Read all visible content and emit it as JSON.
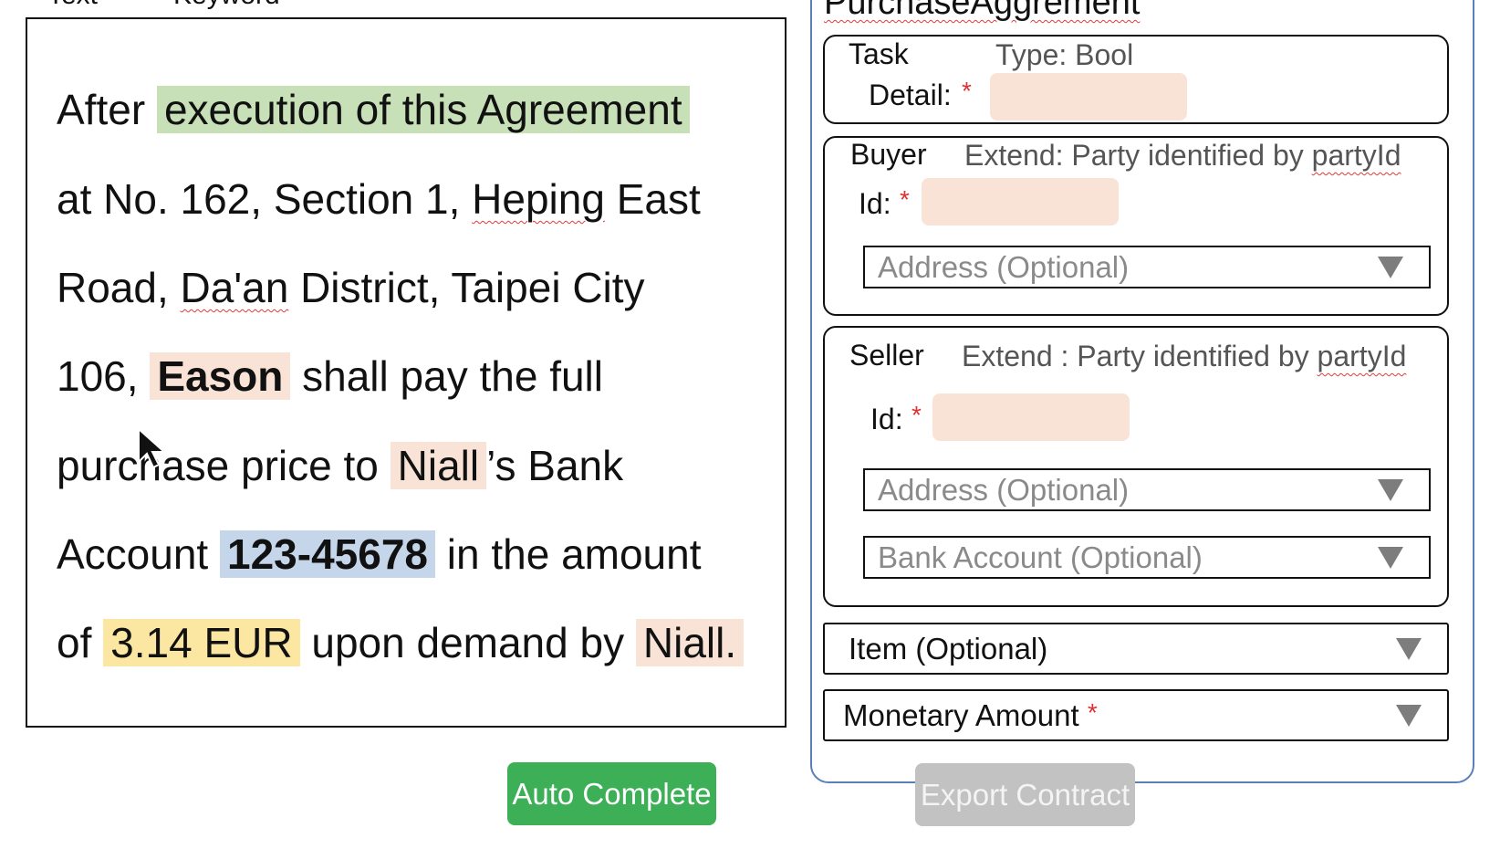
{
  "top_labels": {
    "text": "Text",
    "keyword": "Keyword"
  },
  "form": {
    "title": "PurchaseAggrement",
    "task": {
      "label_1": "Task",
      "label_2": "Detail:",
      "type": "Type: Bool",
      "required": "*"
    },
    "buyer": {
      "label": "Buyer",
      "extend_prefix": "Extend: Party identified by ",
      "extend_word": "partyId",
      "id_label": "Id:",
      "required": "*",
      "address_placeholder": "Address (Optional)"
    },
    "seller": {
      "label": "Seller",
      "extend_prefix": "Extend : Party identified by ",
      "extend_word": "partyId",
      "id_label": "Id:",
      "required": "*",
      "address_placeholder": "Address (Optional)",
      "bank_placeholder": "Bank Account (Optional)"
    },
    "item": {
      "label": "Item (Optional)"
    },
    "monetary": {
      "label": "Monetary Amount",
      "required": "*"
    }
  },
  "contract_text": {
    "l1_a": "After ",
    "l1_hl": "execution of this Agreement",
    "l2_a": "at No. 162, Section 1, ",
    "l2_sq": "Heping",
    "l2_b": " East",
    "l3_a": "Road, ",
    "l3_sq": "Da'an",
    "l3_b": " District, Taipei City",
    "l4_a": "106, ",
    "l4_hl": "Eason",
    "l4_b": " shall pay the full",
    "l5_a": "purchase price to ",
    "l5_hl": "Niall",
    "l5_b": "’s Bank",
    "l6_a": "Account ",
    "l6_hl": "123-45678",
    "l6_b": " in the amount",
    "l7_a": "of ",
    "l7_hl": "3.14 EUR",
    "l7_b": " upon demand by ",
    "l7_hl2": "Niall."
  },
  "buttons": {
    "auto_complete": "Auto Complete",
    "export_contract": "Export Contract"
  },
  "colors": {
    "auto_complete": "#3daf57",
    "export_contract": "#c2c2c2",
    "required": "#e03030",
    "form_border": "#5b7fb8"
  }
}
